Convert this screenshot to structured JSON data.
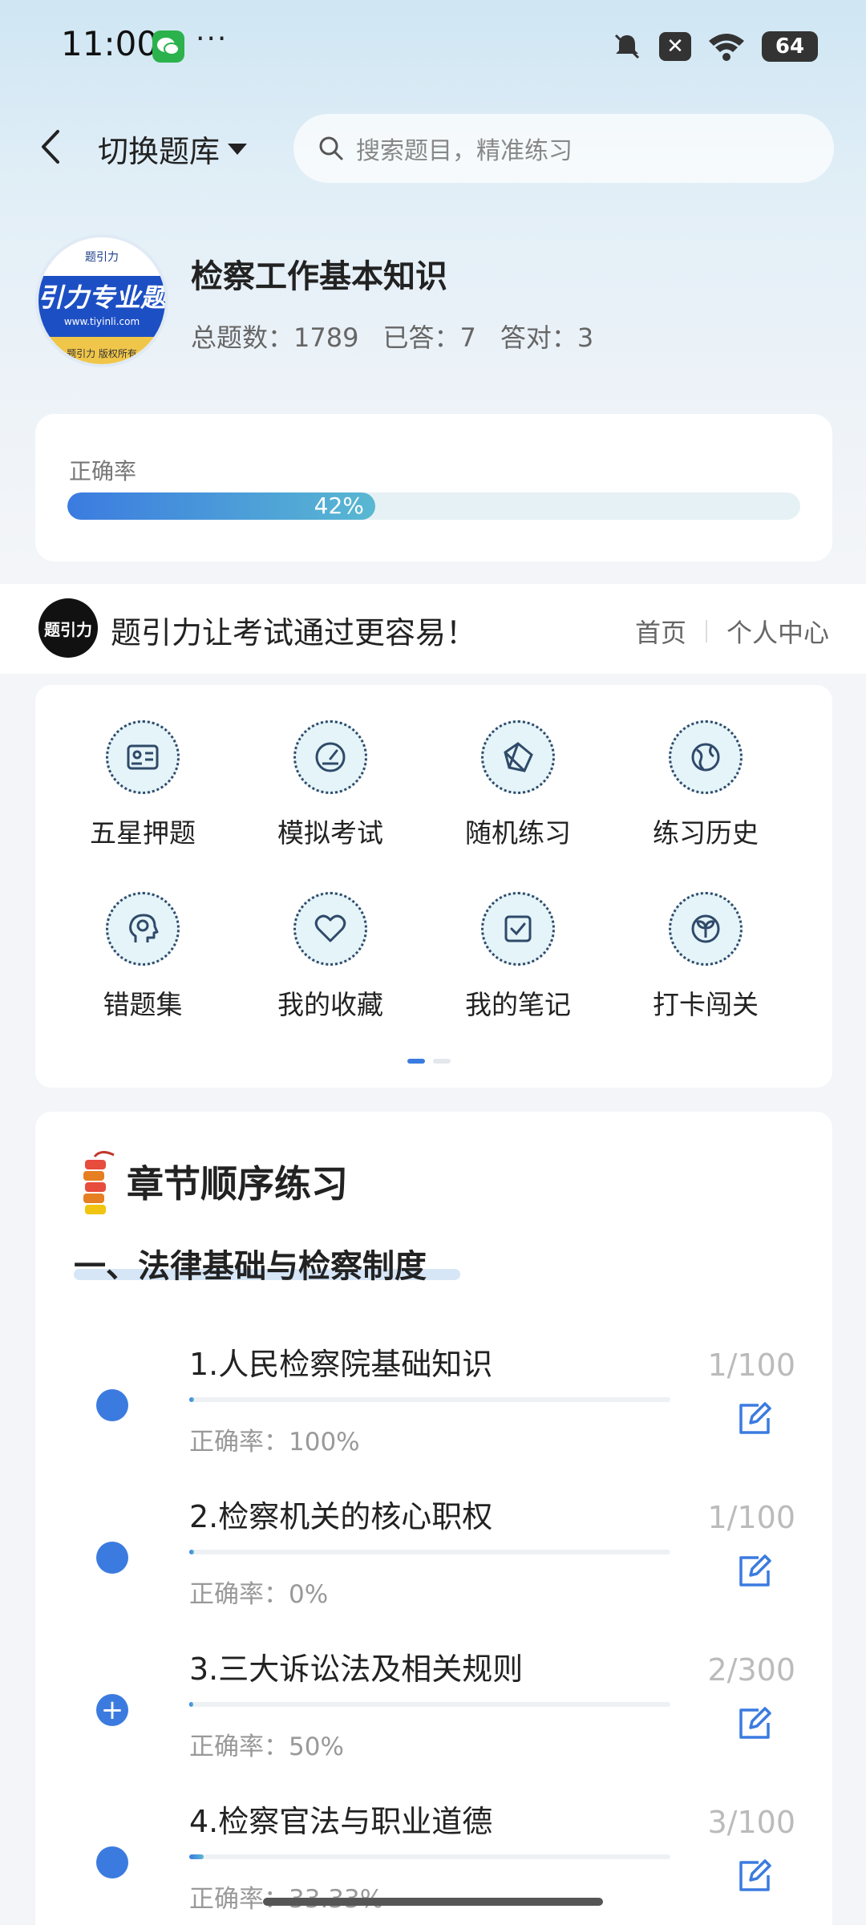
{
  "status": {
    "time": "11:00",
    "dots": "···",
    "battery": "64",
    "x": "✕"
  },
  "header": {
    "switch_label": "切换题库",
    "search_placeholder": "搜索题目，精准练习"
  },
  "bank": {
    "logo": {
      "top": "题引力",
      "band": "引力专业题",
      "url": "www.tiyinli.com",
      "copy": "题引力 版权所有"
    },
    "title": "检察工作基本知识",
    "total": "总题数：1789",
    "answered": "已答：7",
    "correct": "答对：3"
  },
  "accuracy": {
    "label": "正确率",
    "percent_text": "42%",
    "value": 0.42
  },
  "promo": {
    "logo_text": "题引力",
    "text": "题引力让考试通过更容易！",
    "home": "首页",
    "profile": "个人中心"
  },
  "grid": [
    {
      "label": "五星押题",
      "icon": "id-card-icon"
    },
    {
      "label": "模拟考试",
      "icon": "gauge-icon"
    },
    {
      "label": "随机练习",
      "icon": "shuffle-icon"
    },
    {
      "label": "练习历史",
      "icon": "globe-icon"
    },
    {
      "label": "错题集",
      "icon": "brain-head-icon"
    },
    {
      "label": "我的收藏",
      "icon": "heart-icon"
    },
    {
      "label": "我的笔记",
      "icon": "note-check-icon"
    },
    {
      "label": "打卡闯关",
      "icon": "sprout-icon"
    }
  ],
  "chapters_card": {
    "title": "章节顺序练习",
    "section": "一、法律基础与检察制度",
    "items": [
      {
        "name": "1.人民检察院基础知识",
        "accuracy": "正确率：100%",
        "count": "1/100",
        "progress": 0.01,
        "dot": ""
      },
      {
        "name": "2.检察机关的核心职权",
        "accuracy": "正确率：0%",
        "count": "1/100",
        "progress": 0.01,
        "dot": ""
      },
      {
        "name": "3.三大诉讼法及相关规则",
        "accuracy": "正确率：50%",
        "count": "2/300",
        "progress": 0.007,
        "dot": "+"
      },
      {
        "name": "4.检察官法与职业道德",
        "accuracy": "正确率：33.33%",
        "count": "3/100",
        "progress": 0.03,
        "dot": ""
      }
    ]
  },
  "colors": {
    "accent": "#3b7be0",
    "teal": "#59b8d2"
  }
}
